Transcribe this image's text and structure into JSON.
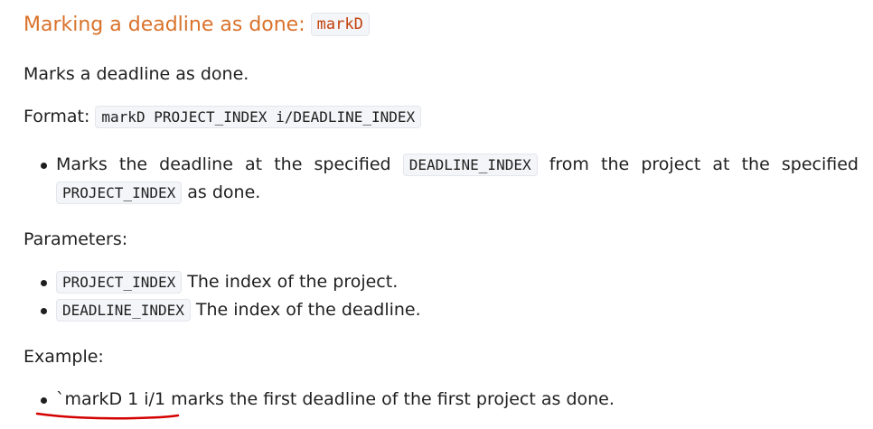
{
  "heading": {
    "text": "Marking a deadline as done:",
    "command": "markD"
  },
  "description": "Marks a deadline as done.",
  "format": {
    "label": "Format:",
    "code": "markD PROJECT_INDEX i/DEADLINE_INDEX"
  },
  "format_bullet": {
    "part1": "Marks the deadline at the specified",
    "code1": "DEADLINE_INDEX",
    "part2": "from the project at the specified",
    "code2": "PROJECT_INDEX",
    "part3": "as done."
  },
  "parameters": {
    "label": "Parameters:",
    "items": [
      {
        "code": "PROJECT_INDEX",
        "text": "The index of the project."
      },
      {
        "code": "DEADLINE_INDEX",
        "text": "The index of the deadline."
      }
    ]
  },
  "example": {
    "label": "Example:",
    "text": "`markD 1 i/1 marks the first deadline of the first project as done."
  },
  "colors": {
    "heading": "#d9722b",
    "code_blue": "#2a5da8",
    "annotation_red": "#d40000"
  }
}
